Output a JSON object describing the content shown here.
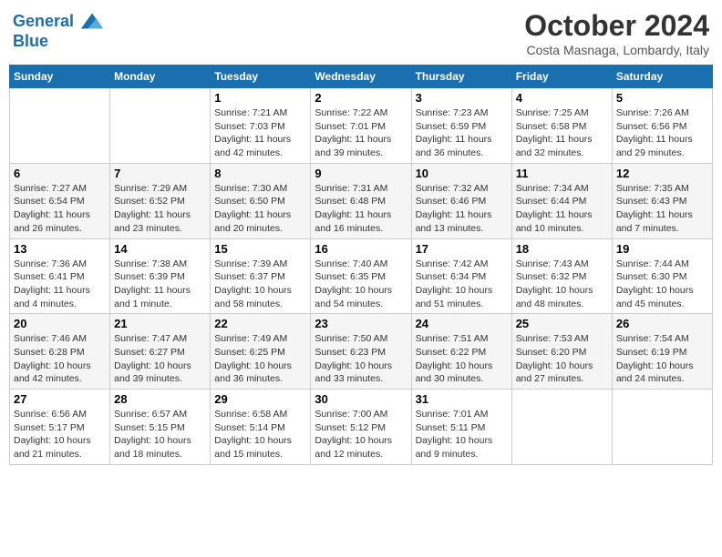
{
  "header": {
    "logo_line1": "General",
    "logo_line2": "Blue",
    "month": "October 2024",
    "location": "Costa Masnaga, Lombardy, Italy"
  },
  "weekdays": [
    "Sunday",
    "Monday",
    "Tuesday",
    "Wednesday",
    "Thursday",
    "Friday",
    "Saturday"
  ],
  "weeks": [
    [
      {
        "day": "",
        "info": ""
      },
      {
        "day": "",
        "info": ""
      },
      {
        "day": "1",
        "info": "Sunrise: 7:21 AM\nSunset: 7:03 PM\nDaylight: 11 hours and 42 minutes."
      },
      {
        "day": "2",
        "info": "Sunrise: 7:22 AM\nSunset: 7:01 PM\nDaylight: 11 hours and 39 minutes."
      },
      {
        "day": "3",
        "info": "Sunrise: 7:23 AM\nSunset: 6:59 PM\nDaylight: 11 hours and 36 minutes."
      },
      {
        "day": "4",
        "info": "Sunrise: 7:25 AM\nSunset: 6:58 PM\nDaylight: 11 hours and 32 minutes."
      },
      {
        "day": "5",
        "info": "Sunrise: 7:26 AM\nSunset: 6:56 PM\nDaylight: 11 hours and 29 minutes."
      }
    ],
    [
      {
        "day": "6",
        "info": "Sunrise: 7:27 AM\nSunset: 6:54 PM\nDaylight: 11 hours and 26 minutes."
      },
      {
        "day": "7",
        "info": "Sunrise: 7:29 AM\nSunset: 6:52 PM\nDaylight: 11 hours and 23 minutes."
      },
      {
        "day": "8",
        "info": "Sunrise: 7:30 AM\nSunset: 6:50 PM\nDaylight: 11 hours and 20 minutes."
      },
      {
        "day": "9",
        "info": "Sunrise: 7:31 AM\nSunset: 6:48 PM\nDaylight: 11 hours and 16 minutes."
      },
      {
        "day": "10",
        "info": "Sunrise: 7:32 AM\nSunset: 6:46 PM\nDaylight: 11 hours and 13 minutes."
      },
      {
        "day": "11",
        "info": "Sunrise: 7:34 AM\nSunset: 6:44 PM\nDaylight: 11 hours and 10 minutes."
      },
      {
        "day": "12",
        "info": "Sunrise: 7:35 AM\nSunset: 6:43 PM\nDaylight: 11 hours and 7 minutes."
      }
    ],
    [
      {
        "day": "13",
        "info": "Sunrise: 7:36 AM\nSunset: 6:41 PM\nDaylight: 11 hours and 4 minutes."
      },
      {
        "day": "14",
        "info": "Sunrise: 7:38 AM\nSunset: 6:39 PM\nDaylight: 11 hours and 1 minute."
      },
      {
        "day": "15",
        "info": "Sunrise: 7:39 AM\nSunset: 6:37 PM\nDaylight: 10 hours and 58 minutes."
      },
      {
        "day": "16",
        "info": "Sunrise: 7:40 AM\nSunset: 6:35 PM\nDaylight: 10 hours and 54 minutes."
      },
      {
        "day": "17",
        "info": "Sunrise: 7:42 AM\nSunset: 6:34 PM\nDaylight: 10 hours and 51 minutes."
      },
      {
        "day": "18",
        "info": "Sunrise: 7:43 AM\nSunset: 6:32 PM\nDaylight: 10 hours and 48 minutes."
      },
      {
        "day": "19",
        "info": "Sunrise: 7:44 AM\nSunset: 6:30 PM\nDaylight: 10 hours and 45 minutes."
      }
    ],
    [
      {
        "day": "20",
        "info": "Sunrise: 7:46 AM\nSunset: 6:28 PM\nDaylight: 10 hours and 42 minutes."
      },
      {
        "day": "21",
        "info": "Sunrise: 7:47 AM\nSunset: 6:27 PM\nDaylight: 10 hours and 39 minutes."
      },
      {
        "day": "22",
        "info": "Sunrise: 7:49 AM\nSunset: 6:25 PM\nDaylight: 10 hours and 36 minutes."
      },
      {
        "day": "23",
        "info": "Sunrise: 7:50 AM\nSunset: 6:23 PM\nDaylight: 10 hours and 33 minutes."
      },
      {
        "day": "24",
        "info": "Sunrise: 7:51 AM\nSunset: 6:22 PM\nDaylight: 10 hours and 30 minutes."
      },
      {
        "day": "25",
        "info": "Sunrise: 7:53 AM\nSunset: 6:20 PM\nDaylight: 10 hours and 27 minutes."
      },
      {
        "day": "26",
        "info": "Sunrise: 7:54 AM\nSunset: 6:19 PM\nDaylight: 10 hours and 24 minutes."
      }
    ],
    [
      {
        "day": "27",
        "info": "Sunrise: 6:56 AM\nSunset: 5:17 PM\nDaylight: 10 hours and 21 minutes."
      },
      {
        "day": "28",
        "info": "Sunrise: 6:57 AM\nSunset: 5:15 PM\nDaylight: 10 hours and 18 minutes."
      },
      {
        "day": "29",
        "info": "Sunrise: 6:58 AM\nSunset: 5:14 PM\nDaylight: 10 hours and 15 minutes."
      },
      {
        "day": "30",
        "info": "Sunrise: 7:00 AM\nSunset: 5:12 PM\nDaylight: 10 hours and 12 minutes."
      },
      {
        "day": "31",
        "info": "Sunrise: 7:01 AM\nSunset: 5:11 PM\nDaylight: 10 hours and 9 minutes."
      },
      {
        "day": "",
        "info": ""
      },
      {
        "day": "",
        "info": ""
      }
    ]
  ]
}
